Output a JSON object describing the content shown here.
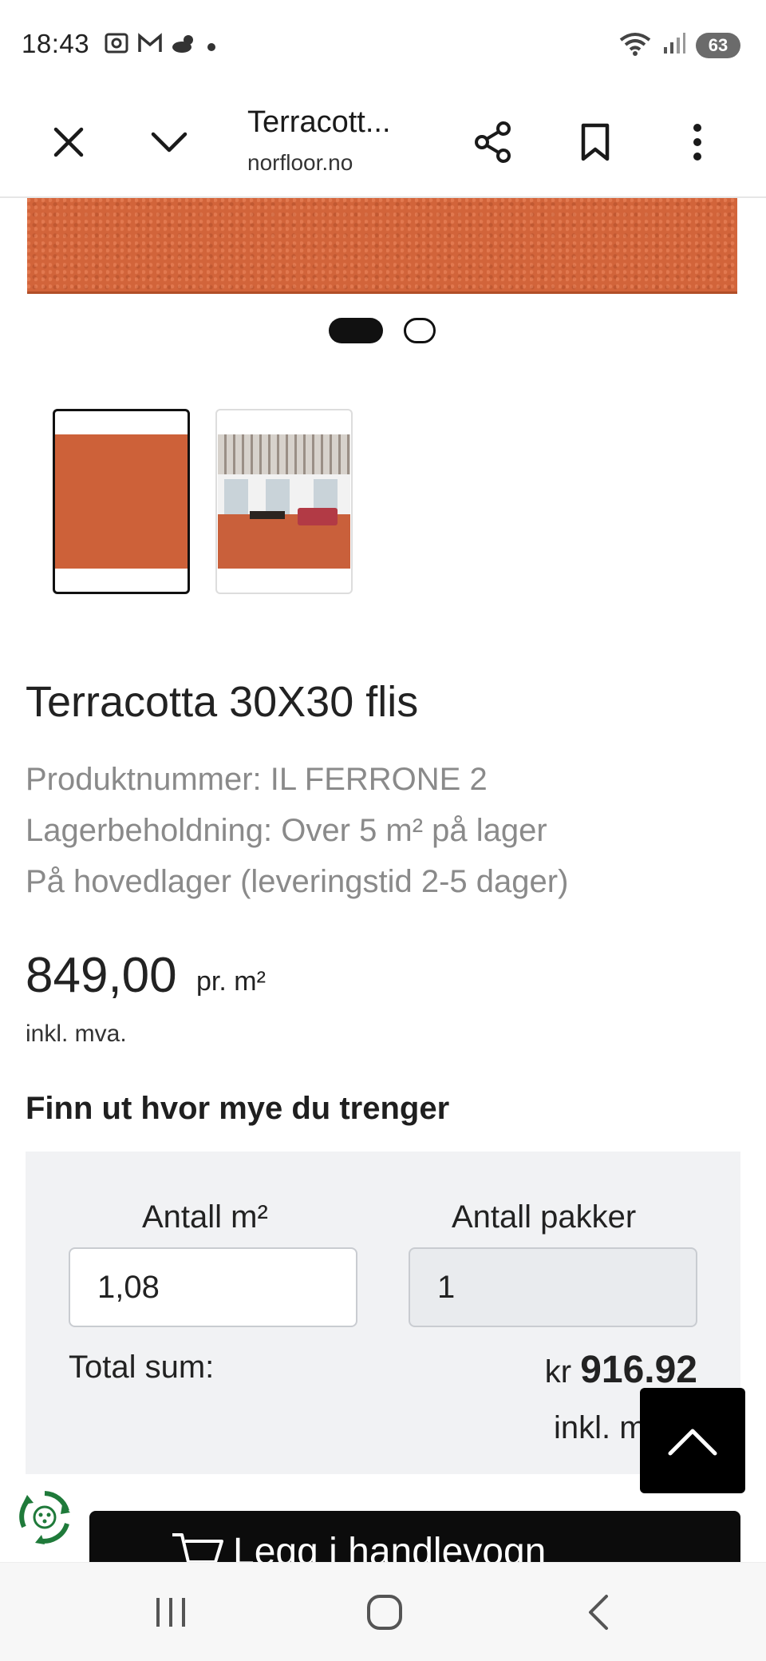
{
  "status_bar": {
    "time": "18:43",
    "battery": "63",
    "icons": [
      "screenshot-icon",
      "gmail-icon",
      "weather-icon",
      "dot-icon",
      "wifi-icon",
      "signal-icon",
      "battery-icon"
    ]
  },
  "browser": {
    "title": "Terracott...",
    "url": "norfloor.no"
  },
  "product": {
    "title": "Terracotta 30X30 flis",
    "product_number": "Produktnummer: IL FERRONE 2",
    "stock": "Lagerbeholdning: Over 5 m² på lager",
    "delivery": "På hovedlager (leveringstid 2-5 dager)",
    "price": "849,00",
    "price_unit": "pr. m²",
    "vat": "inkl. mva."
  },
  "carousel": {
    "slide_count": 2,
    "active_index": 0
  },
  "calculator": {
    "heading": "Finn ut hvor mye du trenger",
    "area_label": "Antall m²",
    "area_value": "1,08",
    "packs_label": "Antall pakker",
    "packs_value": "1",
    "total_label": "Total sum:",
    "total_currency": "kr",
    "total_amount": "916.92",
    "total_vat": "inkl. m"
  },
  "cart": {
    "label": "Legg i handlevogn"
  },
  "colors": {
    "terracotta": "#cd6139",
    "calc_bg": "#f1f2f4",
    "button_dark": "#0c0c0c"
  }
}
